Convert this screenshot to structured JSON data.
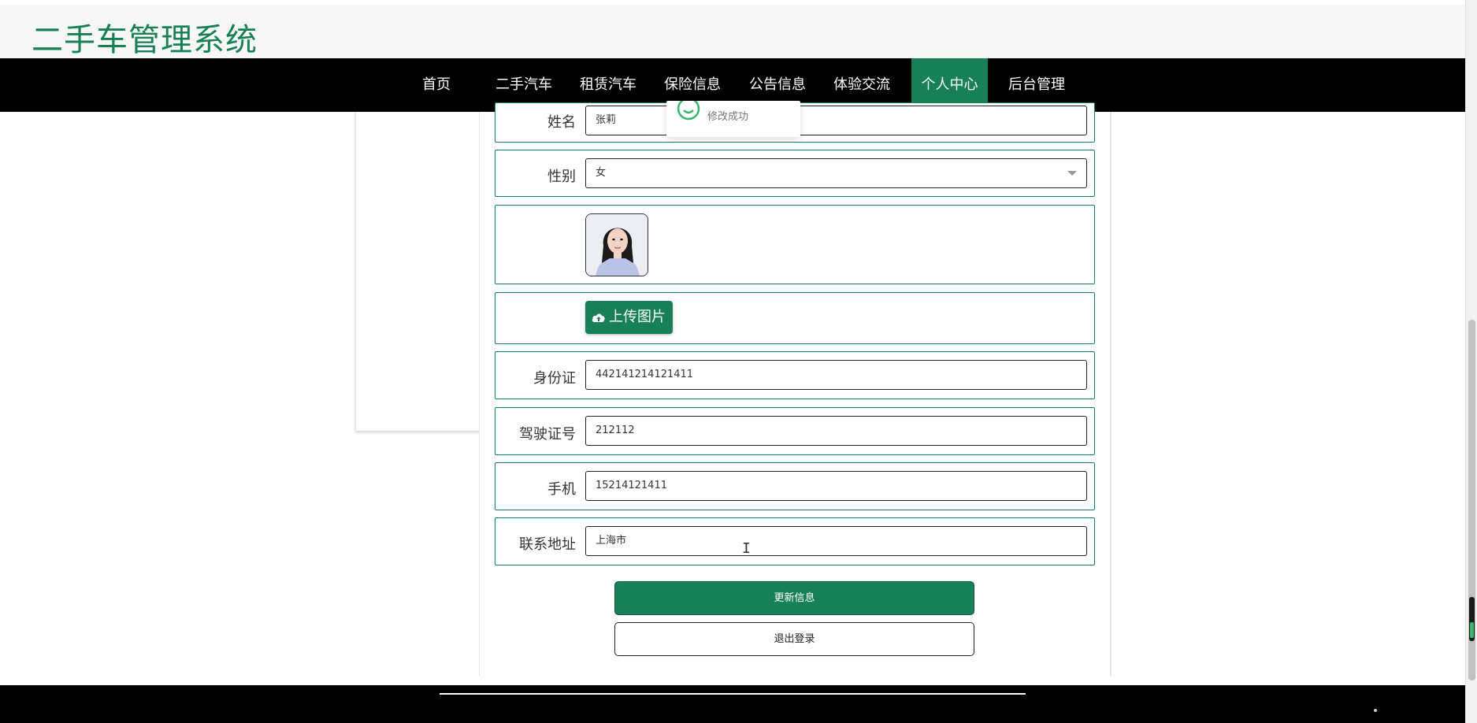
{
  "header": {
    "site_title": "二手车管理系统"
  },
  "nav": {
    "items": [
      {
        "label": "首页"
      },
      {
        "label": "二手汽车"
      },
      {
        "label": "租赁汽车"
      },
      {
        "label": "保险信息"
      },
      {
        "label": "公告信息"
      },
      {
        "label": "体验交流"
      },
      {
        "label": "个人中心"
      },
      {
        "label": "后台管理"
      }
    ],
    "active": "个人中心"
  },
  "toast": {
    "message": "修改成功"
  },
  "form": {
    "name": {
      "label": "姓名",
      "value": "张莉"
    },
    "gender": {
      "label": "性别",
      "value": "女"
    },
    "upload": {
      "label": "上传图片"
    },
    "id_card": {
      "label": "身份证",
      "value": "442141214121411"
    },
    "license": {
      "label": "驾驶证号",
      "value": "212112"
    },
    "phone": {
      "label": "手机",
      "value": "15214121411"
    },
    "address": {
      "label": "联系地址",
      "value": "上海市"
    }
  },
  "buttons": {
    "update": "更新信息",
    "logout": "退出登录"
  },
  "colors": {
    "accent": "#178056",
    "nav_bg": "#000000",
    "header_bg": "#f7f7f7"
  }
}
